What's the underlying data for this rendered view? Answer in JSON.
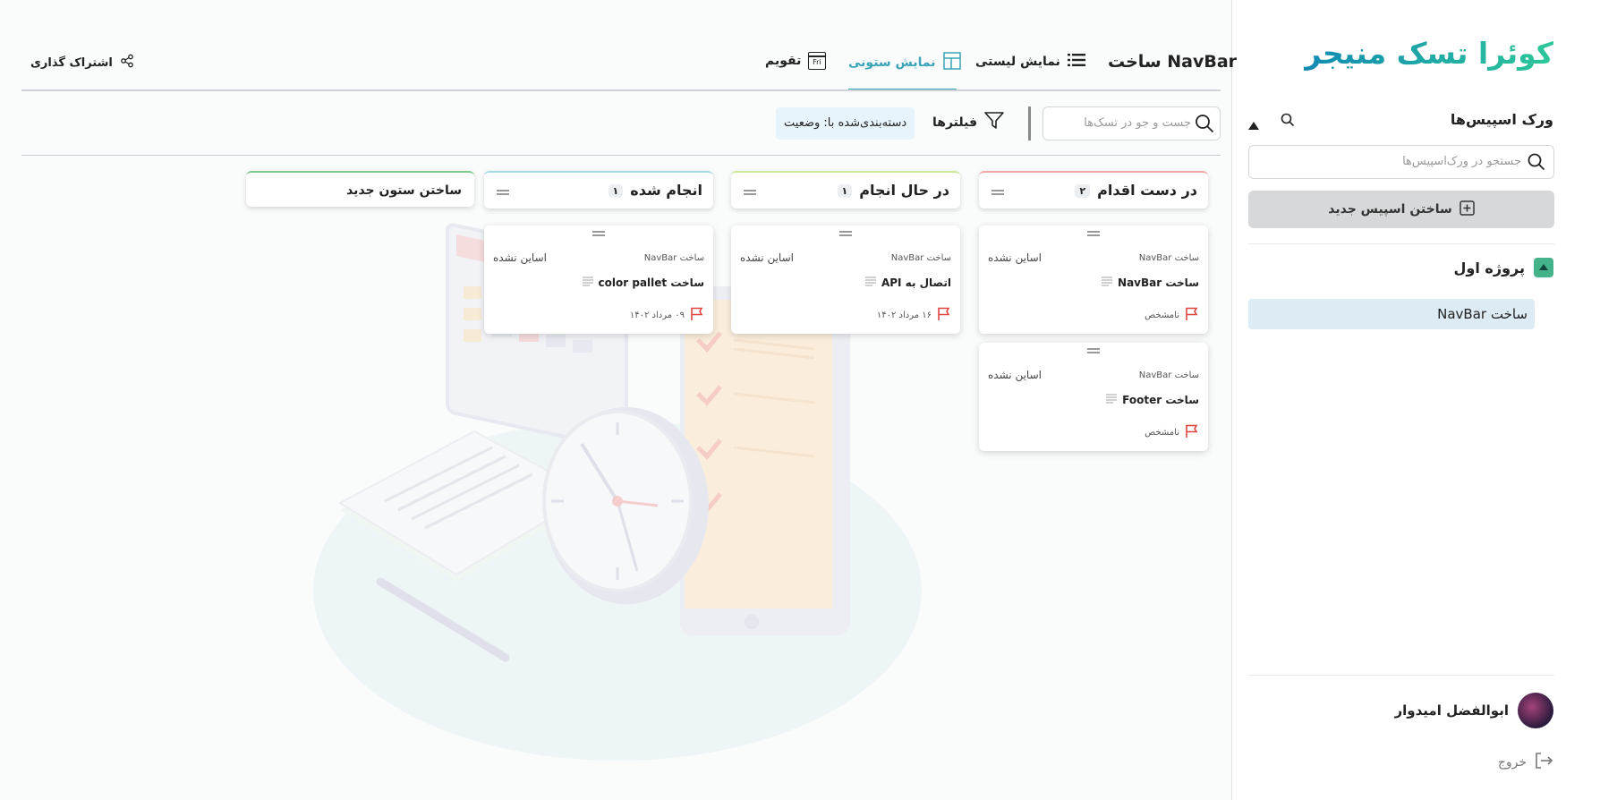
{
  "sidebar": {
    "logo": "کوئرا تسک منیجر",
    "workspaces_title": "ورک اسپیس‌ها",
    "search_placeholder": "جستجو در ورک‌اسپیس‌ها",
    "create_workspace": "ساختن اسپیس جدید",
    "project_name": "پروژه اول",
    "active_item": "ساخت NavBar",
    "user_name": "ابوالفضل امیدوار",
    "logout": "خروج"
  },
  "header": {
    "title": "ساخت NavBar",
    "tabs": [
      {
        "label": "نمایش لیستی",
        "icon": "list-icon",
        "active": false
      },
      {
        "label": "نمایش ستونی",
        "icon": "column-layout-icon",
        "active": true
      },
      {
        "label": "تقویم",
        "icon": "calendar-icon",
        "active": false
      }
    ],
    "calendar_icon_text": "Fri",
    "share": "اشتراک گذاری"
  },
  "toolbar": {
    "search_placeholder": "جست و جو در تسک‌ها",
    "filters": "فیلترها",
    "group_by": "دسته‌بندی‌شده با: وضعیت"
  },
  "columns": [
    {
      "name": "در دست اقدام",
      "count": "۲",
      "border_color": "#f3a9a9",
      "cards": [
        {
          "project": "ساخت NavBar",
          "assignee": "اساین نشده",
          "title": "ساخت NavBar",
          "date": "نامشخص"
        },
        {
          "project": "ساخت NavBar",
          "assignee": "اساین نشده",
          "title": "ساخت Footer",
          "date": "نامشخص"
        }
      ]
    },
    {
      "name": "در حال انجام",
      "count": "۱",
      "border_color": "#cfe89c",
      "cards": [
        {
          "project": "ساخت NavBar",
          "assignee": "اساین نشده",
          "title": "اتصال به API",
          "date": "۱۶ مرداد ۱۴۰۲"
        }
      ]
    },
    {
      "name": "انجام شده",
      "count": "۱",
      "border_color": "#a6dbe6",
      "cards": [
        {
          "project": "ساخت NavBar",
          "assignee": "اساین نشده",
          "title": "ساخت color pallet",
          "date": "۰۹ مرداد ۱۴۰۲"
        }
      ]
    }
  ],
  "new_column": "ساختن ستون جدید",
  "colors": {
    "accent": "#3aa4b9",
    "brand_gradient_start": "#118ab2",
    "brand_gradient_end": "#2ec79a",
    "flag": "#e0453f"
  }
}
